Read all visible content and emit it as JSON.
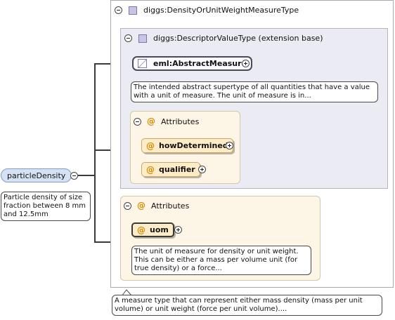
{
  "type_box": {
    "title": "diggs:DensityOrUnitWeightMeasureType"
  },
  "base_box": {
    "title": "diggs:DescriptorValueType (extension base)"
  },
  "abstract_measure": {
    "label": "eml:AbstractMeasure",
    "note": "The intended abstract supertype of all quantities that have a value with a unit of measure. The unit of measure is in..."
  },
  "base_attributes": {
    "title": "Attributes",
    "items": [
      "howDetermined",
      "qualifier"
    ]
  },
  "type_attributes": {
    "title": "Attributes",
    "uom_label": "uom",
    "uom_note": "The unit of measure for density or unit weight. This can be either a mass per volume unit (for true density) or a force..."
  },
  "root": {
    "label": "particleDensity",
    "note": "Particle density of size fraction between 8 mm and 12.5mm"
  },
  "type_note": "A measure type that can represent either mass density (mass per unit volume) or unit weight (force per unit volume)....",
  "colors": {
    "root_fill": "#d5e2f4",
    "attribute_fill": "#fdecc7",
    "base_fill": "#ebebf3",
    "attr_group_fill": "#fdf6e6",
    "attribute_marker": "#d68a00"
  }
}
